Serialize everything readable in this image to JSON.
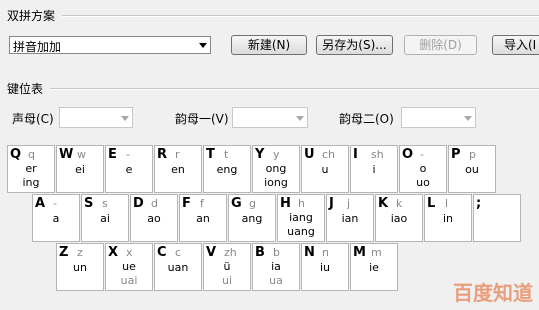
{
  "scheme_group": {
    "title": "双拼方案"
  },
  "scheme_select": {
    "value": "拼音加加"
  },
  "buttons": {
    "new": "新建(N)",
    "save_as": "另存为(S)...",
    "delete": "删除(D)",
    "import": "导入(I"
  },
  "keymap_group": {
    "title": "键位表"
  },
  "filters": {
    "initial": "声母(C)",
    "final1": "韵母一(V)",
    "final2": "韵母二(O)"
  },
  "keys": [
    {
      "key": "Q",
      "initial": "q",
      "finals": [
        "er",
        "ing"
      ]
    },
    {
      "key": "W",
      "initial": "w",
      "finals": [
        "ei"
      ]
    },
    {
      "key": "E",
      "initial": "-",
      "finals": [
        "e"
      ]
    },
    {
      "key": "R",
      "initial": "r",
      "finals": [
        "en"
      ]
    },
    {
      "key": "T",
      "initial": "t",
      "finals": [
        "eng"
      ]
    },
    {
      "key": "Y",
      "initial": "y",
      "finals": [
        "ong",
        "iong"
      ]
    },
    {
      "key": "U",
      "initial": "ch",
      "finals": [
        "u"
      ]
    },
    {
      "key": "I",
      "initial": "sh",
      "finals": [
        "i"
      ]
    },
    {
      "key": "O",
      "initial": "-",
      "finals": [
        "o",
        "uo"
      ]
    },
    {
      "key": "P",
      "initial": "p",
      "finals": [
        "ou"
      ]
    },
    {
      "key": "A",
      "initial": "-",
      "finals": [
        "a"
      ]
    },
    {
      "key": "S",
      "initial": "s",
      "finals": [
        "ai"
      ]
    },
    {
      "key": "D",
      "initial": "d",
      "finals": [
        "ao"
      ]
    },
    {
      "key": "F",
      "initial": "f",
      "finals": [
        "an"
      ]
    },
    {
      "key": "G",
      "initial": "g",
      "finals": [
        "ang"
      ]
    },
    {
      "key": "H",
      "initial": "h",
      "finals": [
        "iang",
        "uang"
      ]
    },
    {
      "key": "J",
      "initial": "j",
      "finals": [
        "ian"
      ]
    },
    {
      "key": "K",
      "initial": "k",
      "finals": [
        "iao"
      ]
    },
    {
      "key": "L",
      "initial": "l",
      "finals": [
        "in"
      ]
    },
    {
      "key": ";",
      "initial": "",
      "finals": []
    },
    {
      "key": "Z",
      "initial": "z",
      "finals": [
        "un"
      ]
    },
    {
      "key": "X",
      "initial": "x",
      "finals": [
        "ue",
        "uai"
      ]
    },
    {
      "key": "C",
      "initial": "c",
      "finals": [
        "uan"
      ]
    },
    {
      "key": "V",
      "initial": "zh",
      "finals": [
        "ü",
        "ui"
      ]
    },
    {
      "key": "B",
      "initial": "b",
      "finals": [
        "ia",
        "ua"
      ]
    },
    {
      "key": "N",
      "initial": "n",
      "finals": [
        "iu"
      ]
    },
    {
      "key": "M",
      "initial": "m",
      "finals": [
        "ie"
      ]
    }
  ],
  "watermark": "百度知道",
  "colors": {
    "watermark": "#e55a1c"
  }
}
